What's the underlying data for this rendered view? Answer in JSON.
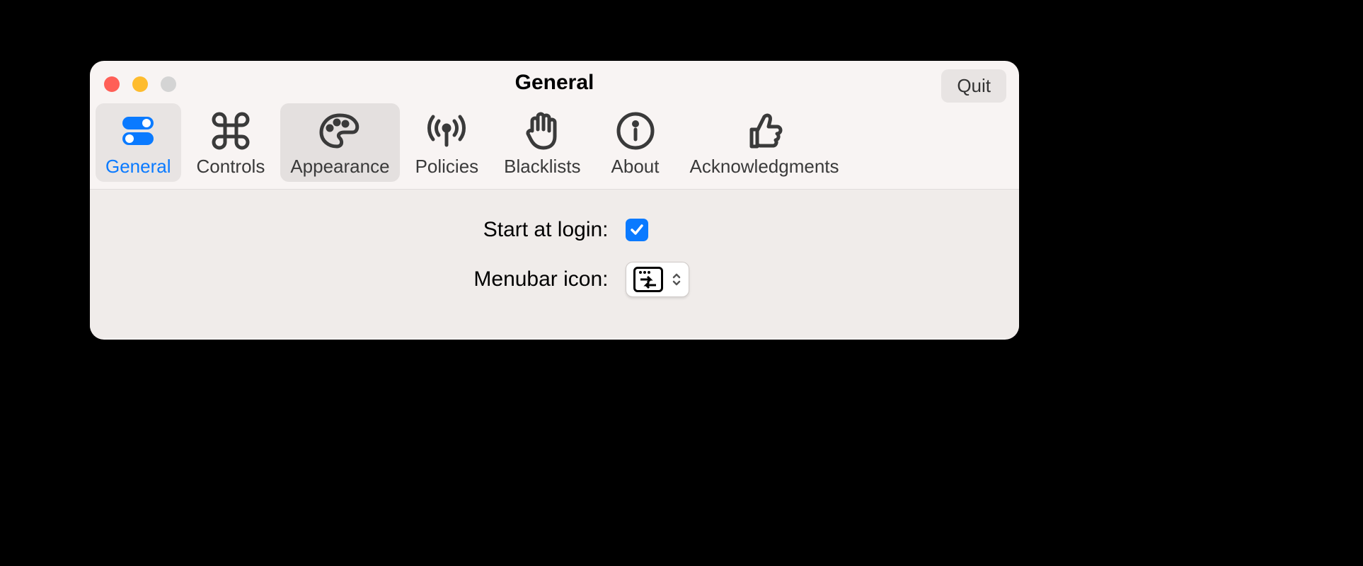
{
  "window": {
    "title": "General",
    "quit_label": "Quit"
  },
  "tabs": [
    {
      "label": "General",
      "icon": "toggles-icon"
    },
    {
      "label": "Controls",
      "icon": "command-icon"
    },
    {
      "label": "Appearance",
      "icon": "palette-icon"
    },
    {
      "label": "Policies",
      "icon": "antenna-icon"
    },
    {
      "label": "Blacklists",
      "icon": "hand-icon"
    },
    {
      "label": "About",
      "icon": "info-icon"
    },
    {
      "label": "Acknowledgments",
      "icon": "thumbsup-icon"
    }
  ],
  "settings": {
    "start_at_login": {
      "label": "Start at login:",
      "checked": true
    },
    "menubar_icon": {
      "label": "Menubar icon:",
      "selected": "arrows-icon"
    }
  }
}
